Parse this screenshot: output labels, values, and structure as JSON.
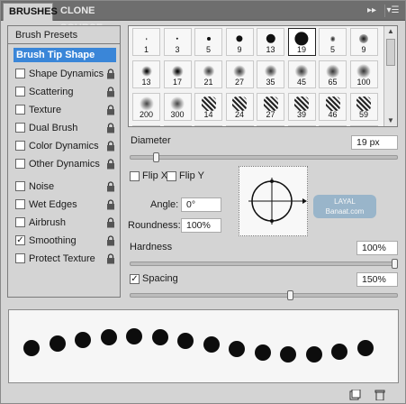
{
  "tabs": {
    "active": "BRUSHES",
    "inactive": "CLONE SOURCE"
  },
  "tabbar": {
    "collapse_icon": "double-chevron-right-icon",
    "menu_icon": "panel-menu-icon"
  },
  "left": {
    "presets": "Brush Presets",
    "tip_shape": "Brush Tip Shape",
    "options": [
      {
        "label": "Shape Dynamics",
        "checked": false
      },
      {
        "label": "Scattering",
        "checked": false
      },
      {
        "label": "Texture",
        "checked": false
      },
      {
        "label": "Dual Brush",
        "checked": false
      },
      {
        "label": "Color Dynamics",
        "checked": false
      },
      {
        "label": "Other Dynamics",
        "checked": false
      },
      {
        "label": "Noise",
        "checked": false
      },
      {
        "label": "Wet Edges",
        "checked": false
      },
      {
        "label": "Airbrush",
        "checked": false
      },
      {
        "label": "Smoothing",
        "checked": true
      },
      {
        "label": "Protect Texture",
        "checked": false
      }
    ],
    "lock_icon": "lock-icon"
  },
  "brush_grid": {
    "row1": [
      "1",
      "3",
      "5",
      "9",
      "13",
      "19",
      "5",
      "9"
    ],
    "row2": [
      "13",
      "17",
      "21",
      "27",
      "35",
      "45",
      "65",
      "100"
    ],
    "row3": [
      "200",
      "300",
      "14",
      "24",
      "27",
      "39",
      "46",
      "59"
    ],
    "selected": "19"
  },
  "controls": {
    "diameter_label": "Diameter",
    "diameter_value": "19 px",
    "diameter_fraction": 0.09,
    "flip_x": "Flip X",
    "flip_y": "Flip Y",
    "angle_label": "Angle:",
    "angle_value": "0°",
    "roundness_label": "Roundness:",
    "roundness_value": "100%",
    "hardness_label": "Hardness",
    "hardness_value": "100%",
    "hardness_fraction": 1.0,
    "spacing_label": "Spacing",
    "spacing_checked": true,
    "spacing_value": "150%",
    "spacing_fraction": 0.6
  },
  "watermark": {
    "line1": "LAYAL",
    "line2": "Banaat.com"
  },
  "bottom_icons": [
    "new-preset-icon",
    "trash-icon"
  ]
}
